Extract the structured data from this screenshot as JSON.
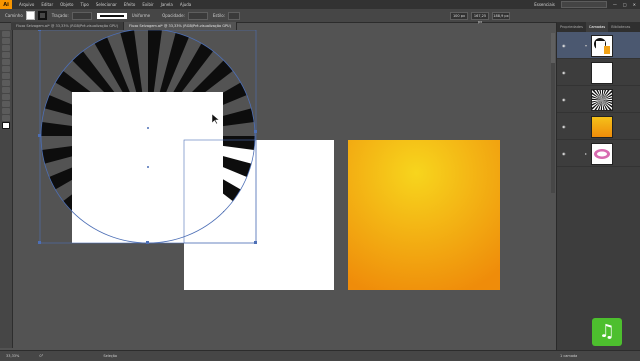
{
  "app": {
    "logo_text": "Ai",
    "menu": [
      "Arquivo",
      "Editar",
      "Objeto",
      "Tipo",
      "Selecionar",
      "Efeito",
      "Exibir",
      "Janela",
      "Ajuda"
    ],
    "workspace": "Essenciais"
  },
  "control_bar": {
    "object_label": "Caminho",
    "stroke_label": "Traçado:",
    "uniform_label": "Uniforme",
    "opacity_label": "Opacidade:",
    "style_label": "Estilo:",
    "width_value": "100 px",
    "x_value": "167,25 px",
    "height_value": "188,9 px"
  },
  "tabs": [
    {
      "label": "Fluxo Selvagem.ai* @ 33,33% (RGB/Pré-visualização GPU)",
      "active": false
    },
    {
      "label": "Fluxo Selvagem.ai* @ 33,33% (RGB/Pré-visualização GPU)",
      "active": true
    }
  ],
  "panel": {
    "tabs": [
      "Propriedades",
      "Camadas",
      "Bibliotecas"
    ],
    "active_tab": "Camadas",
    "layers": [
      {
        "thumb": "sunburst-group",
        "selected": true
      },
      {
        "thumb": "white-square",
        "selected": false
      },
      {
        "thumb": "rays",
        "selected": false
      },
      {
        "thumb": "orange-gradient",
        "selected": false
      },
      {
        "thumb": "logo",
        "selected": false
      }
    ],
    "count_label": "1 camada"
  },
  "status": {
    "zoom": "33,33%",
    "rotation": "0°",
    "mode": "Seleção"
  },
  "colors": {
    "accent": "#f79500",
    "selection": "#4d6fb6",
    "gradient_center": "#f7d51d",
    "gradient_edge": "#ef8c0a",
    "brand": "#4dbf2e"
  },
  "icons": [
    "select-icon",
    "direct-select-icon",
    "pen-icon",
    "type-icon",
    "rectangle-icon",
    "brush-icon",
    "eraser-icon",
    "rotate-icon",
    "scale-icon",
    "gradient-icon",
    "eyedropper-icon",
    "hand-icon",
    "zoom-icon",
    "fill-stroke-icon"
  ]
}
